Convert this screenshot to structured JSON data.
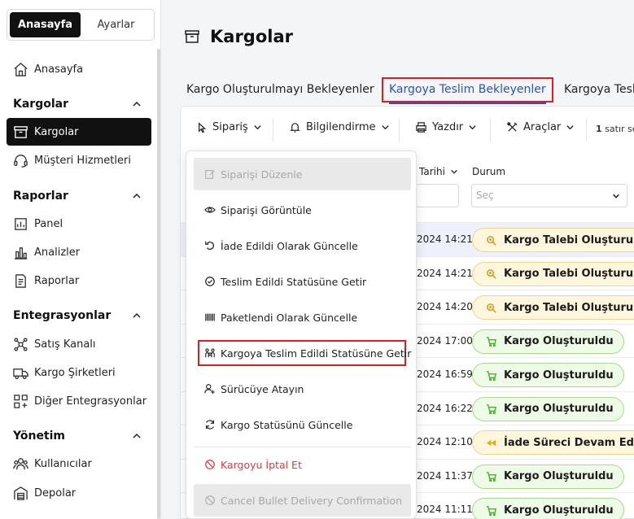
{
  "sidebar": {
    "switch": [
      "Anasayfa",
      "Ayarlar"
    ],
    "home": "Anasayfa",
    "sections": [
      {
        "title": "Kargolar",
        "items": [
          "Kargolar",
          "Müşteri Hizmetleri"
        ]
      },
      {
        "title": "Raporlar",
        "items": [
          "Panel",
          "Analizler",
          "Raporlar"
        ]
      },
      {
        "title": "Entegrasyonlar",
        "items": [
          "Satış Kanalı",
          "Kargo Şirketleri",
          "Diğer Entegrasyonlar"
        ]
      },
      {
        "title": "Yönetim",
        "items": [
          "Kullanıcılar",
          "Depolar"
        ]
      }
    ]
  },
  "page": {
    "title": "Kargolar"
  },
  "tabs": [
    "Kargo Oluşturulmayı Bekleyenler",
    "Kargoya Teslim Bekleyenler",
    "Kargoya Tesl"
  ],
  "toolbar": {
    "buttons": [
      "Sipariş",
      "Bilgilendirme",
      "Yazdır",
      "Araçlar"
    ],
    "selection_count": "1",
    "selection_text": "satır se"
  },
  "table": {
    "headers": {
      "date": "Tarihi",
      "status": "Durum"
    },
    "status_placeholder": "Seç",
    "rows": [
      {
        "date": "2024 14:21",
        "status": "Kargo Talebi Oluşturul...",
        "tone": "yellow",
        "selected": true
      },
      {
        "date": "2024 14:21",
        "status": "Kargo Talebi Oluşturul...",
        "tone": "yellow"
      },
      {
        "date": "2024 14:20",
        "status": "Kargo Talebi Oluşturul...",
        "tone": "yellow"
      },
      {
        "date": "2024 17:00",
        "status": "Kargo Oluşturuldu",
        "tone": "green"
      },
      {
        "date": "2024 16:59",
        "status": "Kargo Oluşturuldu",
        "tone": "green"
      },
      {
        "date": "2024 16:22",
        "status": "Kargo Oluşturuldu",
        "tone": "green"
      },
      {
        "date": "2024 12:10",
        "status": "İade Süreci Devam Edi...",
        "tone": "yellow"
      },
      {
        "date": "2024 11:37",
        "status": "Kargo Oluşturuldu",
        "tone": "green"
      },
      {
        "date": "2024 11:11",
        "status": "Kargo Oluşturuldu",
        "tone": "green"
      }
    ]
  },
  "menu": {
    "items": [
      "Siparişi Düzenle",
      "Siparişi Görüntüle",
      "İade Edildi Olarak Güncelle",
      "Teslim Edildi Statüsüne Getir",
      "Paketlendi Olarak Güncelle",
      "Kargoya Teslim Edildi Statüsüne Getir",
      "Sürücüye Atayın",
      "Kargo Statüsünü Güncelle",
      "Kargoyu İptal Et",
      "Cancel Bullet Delivery Confirmation"
    ]
  },
  "colors": {
    "accent": "#2a52c9",
    "highlight": "#e01b22",
    "danger": "#e0393e"
  }
}
